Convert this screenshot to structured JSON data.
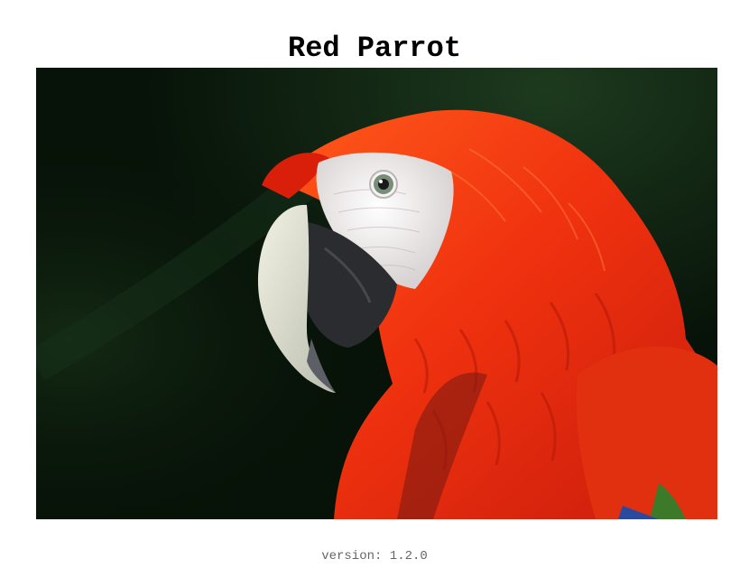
{
  "page": {
    "title": "Red Parrot",
    "version_text": "version: 1.2.0"
  },
  "image": {
    "subject_icon": "parrot-photo",
    "colors": {
      "background": "#071208",
      "plumage": "#e8270f",
      "plumage_light": "#ff5a1a",
      "face": "#eeeeee",
      "beak_upper": "#dcdcc8",
      "beak_lower": "#2a2c30"
    }
  }
}
